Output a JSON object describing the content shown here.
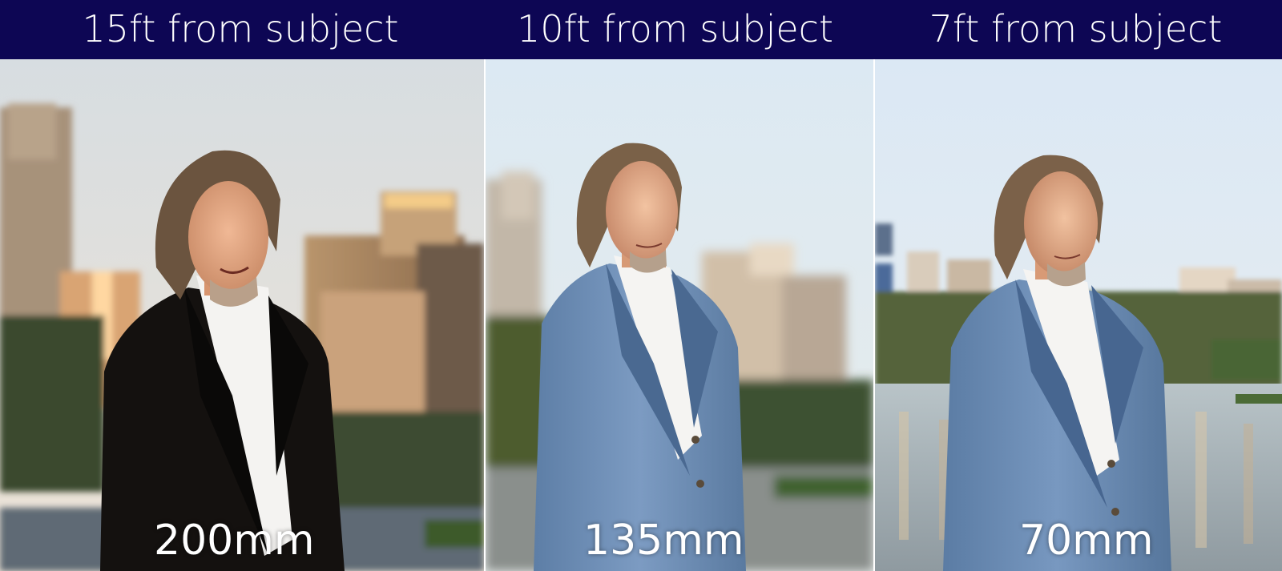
{
  "panels": [
    {
      "distance_caption": "15ft from subject",
      "focal_length_label": "200mm",
      "jacket_color": "#14110f"
    },
    {
      "distance_caption": "10ft from subject",
      "focal_length_label": "135mm",
      "jacket_color": "#6f8fb6"
    },
    {
      "distance_caption": "7ft from subject",
      "focal_length_label": "70mm",
      "jacket_color": "#6f8fb6"
    }
  ],
  "colors": {
    "header_band": "#0d0654",
    "caption_text": "#ffffff",
    "sky_warm": "#d9dde0",
    "sky_cool": "#dbe9f5"
  }
}
